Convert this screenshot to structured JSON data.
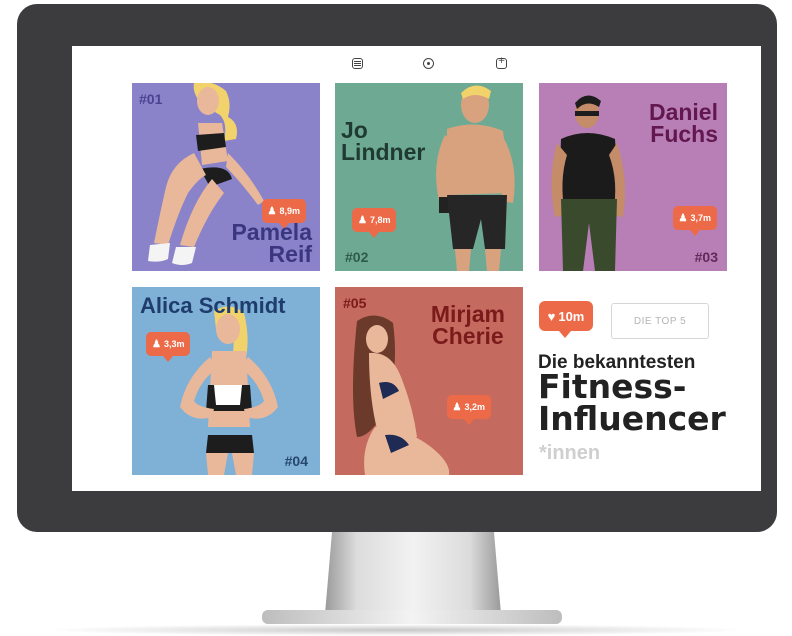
{
  "toolbar": {
    "icons": [
      "list-icon",
      "download-icon",
      "add-icon"
    ]
  },
  "influencers": [
    {
      "rank": "#01",
      "name_line1": "Pamela",
      "name_line2": "Reif",
      "followers": "8,9m"
    },
    {
      "rank": "#02",
      "name_line1": "Jo",
      "name_line2": "Lindner",
      "followers": "7,8m"
    },
    {
      "rank": "#03",
      "name_line1": "Daniel",
      "name_line2": "Fuchs",
      "followers": "3,7m"
    },
    {
      "rank": "#04",
      "name_line1": "Alica Schmidt",
      "name_line2": "",
      "followers": "3,3m"
    },
    {
      "rank": "#05",
      "name_line1": "Mirjam",
      "name_line2": "Cherie",
      "followers": "3,2m"
    }
  ],
  "panel": {
    "likes": "10m",
    "top5_button": "DIE TOP 5",
    "headline_small": "Die bekanntesten",
    "headline_big_1": "Fitness-",
    "headline_big_2": "Influencer",
    "headline_sub": "*innen"
  },
  "colors": {
    "badge": "#ec6a47",
    "card1": "#8a83c9",
    "card2": "#6eaa93",
    "card3": "#b87fb6",
    "card4": "#7fb0d6",
    "card5": "#c56a5e"
  }
}
